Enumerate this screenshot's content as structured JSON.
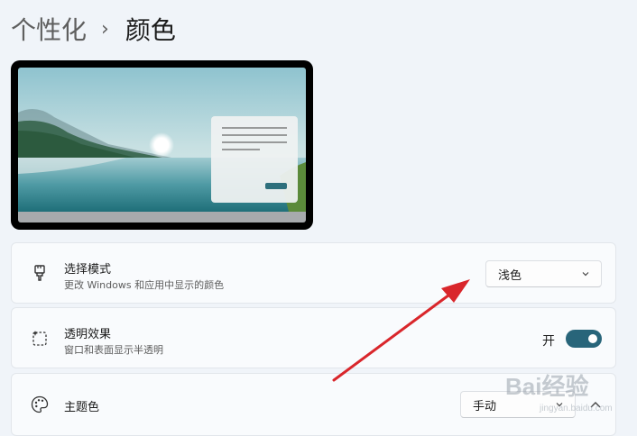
{
  "header": {
    "parent": "个性化",
    "separator": "›",
    "current": "颜色"
  },
  "settings": {
    "mode": {
      "title": "选择模式",
      "description": "更改 Windows 和应用中显示的颜色",
      "value": "浅色",
      "icon": "brush-icon"
    },
    "transparency": {
      "title": "透明效果",
      "description": "窗口和表面显示半透明",
      "state_label": "开",
      "on": true,
      "icon": "transparency-icon"
    },
    "accent": {
      "title": "主题色",
      "value": "手动",
      "icon": "palette-icon"
    }
  },
  "watermark": {
    "text": "Bai经验",
    "subtext": "jingyan.baidu.com"
  },
  "colors": {
    "toggle_on": "#28657a",
    "annotation_arrow": "#d9262b",
    "background": "#f0f4f9"
  }
}
